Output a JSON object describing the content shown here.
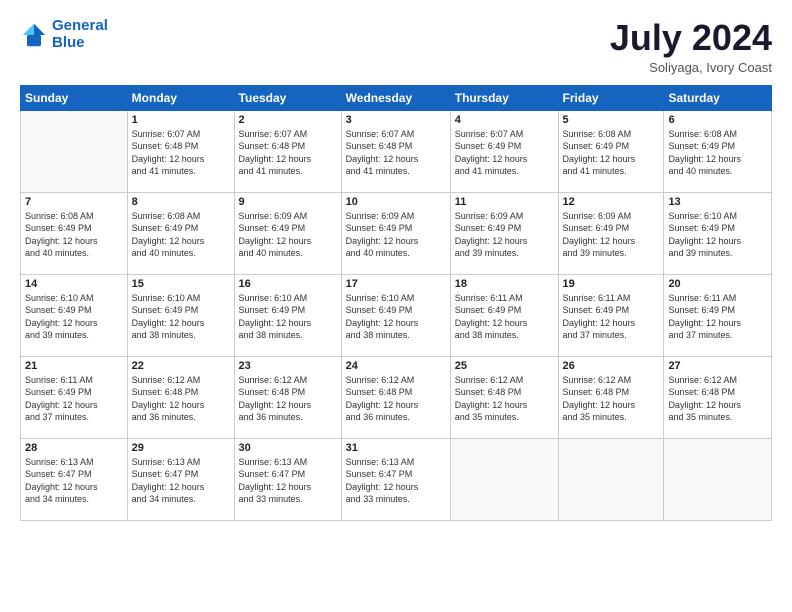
{
  "header": {
    "logo_line1": "General",
    "logo_line2": "Blue",
    "month": "July 2024",
    "location": "Soliyaga, Ivory Coast"
  },
  "days_of_week": [
    "Sunday",
    "Monday",
    "Tuesday",
    "Wednesday",
    "Thursday",
    "Friday",
    "Saturday"
  ],
  "weeks": [
    [
      {
        "day": "",
        "info": ""
      },
      {
        "day": "1",
        "info": "Sunrise: 6:07 AM\nSunset: 6:48 PM\nDaylight: 12 hours\nand 41 minutes."
      },
      {
        "day": "2",
        "info": "Sunrise: 6:07 AM\nSunset: 6:48 PM\nDaylight: 12 hours\nand 41 minutes."
      },
      {
        "day": "3",
        "info": "Sunrise: 6:07 AM\nSunset: 6:48 PM\nDaylight: 12 hours\nand 41 minutes."
      },
      {
        "day": "4",
        "info": "Sunrise: 6:07 AM\nSunset: 6:49 PM\nDaylight: 12 hours\nand 41 minutes."
      },
      {
        "day": "5",
        "info": "Sunrise: 6:08 AM\nSunset: 6:49 PM\nDaylight: 12 hours\nand 41 minutes."
      },
      {
        "day": "6",
        "info": "Sunrise: 6:08 AM\nSunset: 6:49 PM\nDaylight: 12 hours\nand 40 minutes."
      }
    ],
    [
      {
        "day": "7",
        "info": "Sunrise: 6:08 AM\nSunset: 6:49 PM\nDaylight: 12 hours\nand 40 minutes."
      },
      {
        "day": "8",
        "info": "Sunrise: 6:08 AM\nSunset: 6:49 PM\nDaylight: 12 hours\nand 40 minutes."
      },
      {
        "day": "9",
        "info": "Sunrise: 6:09 AM\nSunset: 6:49 PM\nDaylight: 12 hours\nand 40 minutes."
      },
      {
        "day": "10",
        "info": "Sunrise: 6:09 AM\nSunset: 6:49 PM\nDaylight: 12 hours\nand 40 minutes."
      },
      {
        "day": "11",
        "info": "Sunrise: 6:09 AM\nSunset: 6:49 PM\nDaylight: 12 hours\nand 39 minutes."
      },
      {
        "day": "12",
        "info": "Sunrise: 6:09 AM\nSunset: 6:49 PM\nDaylight: 12 hours\nand 39 minutes."
      },
      {
        "day": "13",
        "info": "Sunrise: 6:10 AM\nSunset: 6:49 PM\nDaylight: 12 hours\nand 39 minutes."
      }
    ],
    [
      {
        "day": "14",
        "info": "Sunrise: 6:10 AM\nSunset: 6:49 PM\nDaylight: 12 hours\nand 39 minutes."
      },
      {
        "day": "15",
        "info": "Sunrise: 6:10 AM\nSunset: 6:49 PM\nDaylight: 12 hours\nand 38 minutes."
      },
      {
        "day": "16",
        "info": "Sunrise: 6:10 AM\nSunset: 6:49 PM\nDaylight: 12 hours\nand 38 minutes."
      },
      {
        "day": "17",
        "info": "Sunrise: 6:10 AM\nSunset: 6:49 PM\nDaylight: 12 hours\nand 38 minutes."
      },
      {
        "day": "18",
        "info": "Sunrise: 6:11 AM\nSunset: 6:49 PM\nDaylight: 12 hours\nand 38 minutes."
      },
      {
        "day": "19",
        "info": "Sunrise: 6:11 AM\nSunset: 6:49 PM\nDaylight: 12 hours\nand 37 minutes."
      },
      {
        "day": "20",
        "info": "Sunrise: 6:11 AM\nSunset: 6:49 PM\nDaylight: 12 hours\nand 37 minutes."
      }
    ],
    [
      {
        "day": "21",
        "info": "Sunrise: 6:11 AM\nSunset: 6:49 PM\nDaylight: 12 hours\nand 37 minutes."
      },
      {
        "day": "22",
        "info": "Sunrise: 6:12 AM\nSunset: 6:48 PM\nDaylight: 12 hours\nand 36 minutes."
      },
      {
        "day": "23",
        "info": "Sunrise: 6:12 AM\nSunset: 6:48 PM\nDaylight: 12 hours\nand 36 minutes."
      },
      {
        "day": "24",
        "info": "Sunrise: 6:12 AM\nSunset: 6:48 PM\nDaylight: 12 hours\nand 36 minutes."
      },
      {
        "day": "25",
        "info": "Sunrise: 6:12 AM\nSunset: 6:48 PM\nDaylight: 12 hours\nand 35 minutes."
      },
      {
        "day": "26",
        "info": "Sunrise: 6:12 AM\nSunset: 6:48 PM\nDaylight: 12 hours\nand 35 minutes."
      },
      {
        "day": "27",
        "info": "Sunrise: 6:12 AM\nSunset: 6:48 PM\nDaylight: 12 hours\nand 35 minutes."
      }
    ],
    [
      {
        "day": "28",
        "info": "Sunrise: 6:13 AM\nSunset: 6:47 PM\nDaylight: 12 hours\nand 34 minutes."
      },
      {
        "day": "29",
        "info": "Sunrise: 6:13 AM\nSunset: 6:47 PM\nDaylight: 12 hours\nand 34 minutes."
      },
      {
        "day": "30",
        "info": "Sunrise: 6:13 AM\nSunset: 6:47 PM\nDaylight: 12 hours\nand 33 minutes."
      },
      {
        "day": "31",
        "info": "Sunrise: 6:13 AM\nSunset: 6:47 PM\nDaylight: 12 hours\nand 33 minutes."
      },
      {
        "day": "",
        "info": ""
      },
      {
        "day": "",
        "info": ""
      },
      {
        "day": "",
        "info": ""
      }
    ]
  ]
}
